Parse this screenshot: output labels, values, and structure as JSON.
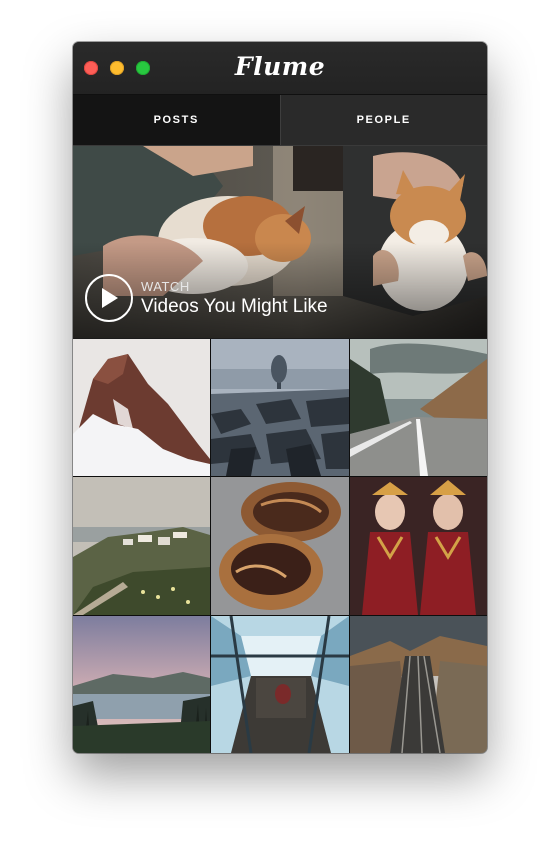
{
  "app": {
    "title": "Flume"
  },
  "tabs": [
    {
      "label": "POSTS",
      "active": true
    },
    {
      "label": "PEOPLE",
      "active": false
    }
  ],
  "hero": {
    "kicker": "WATCH",
    "title": "Videos You Might Like",
    "icon": "play-icon"
  },
  "grid": [
    {
      "subject": "snowy-mountain-peak"
    },
    {
      "subject": "foggy-tree-rocky-ground"
    },
    {
      "subject": "empty-road-hills"
    },
    {
      "subject": "coastal-village-cliffs"
    },
    {
      "subject": "chocolate-pastries"
    },
    {
      "subject": "two-women-red-costumes"
    },
    {
      "subject": "lake-sunset-pines"
    },
    {
      "subject": "glass-building-interior"
    },
    {
      "subject": "railway-tracks-autumn"
    }
  ],
  "colors": {
    "titlebar": "#232323",
    "tab_active": "#141414",
    "tab_inactive": "#2a2a2a",
    "close": "#fd5e57",
    "minimize": "#febc2e",
    "maximize": "#28c840"
  }
}
